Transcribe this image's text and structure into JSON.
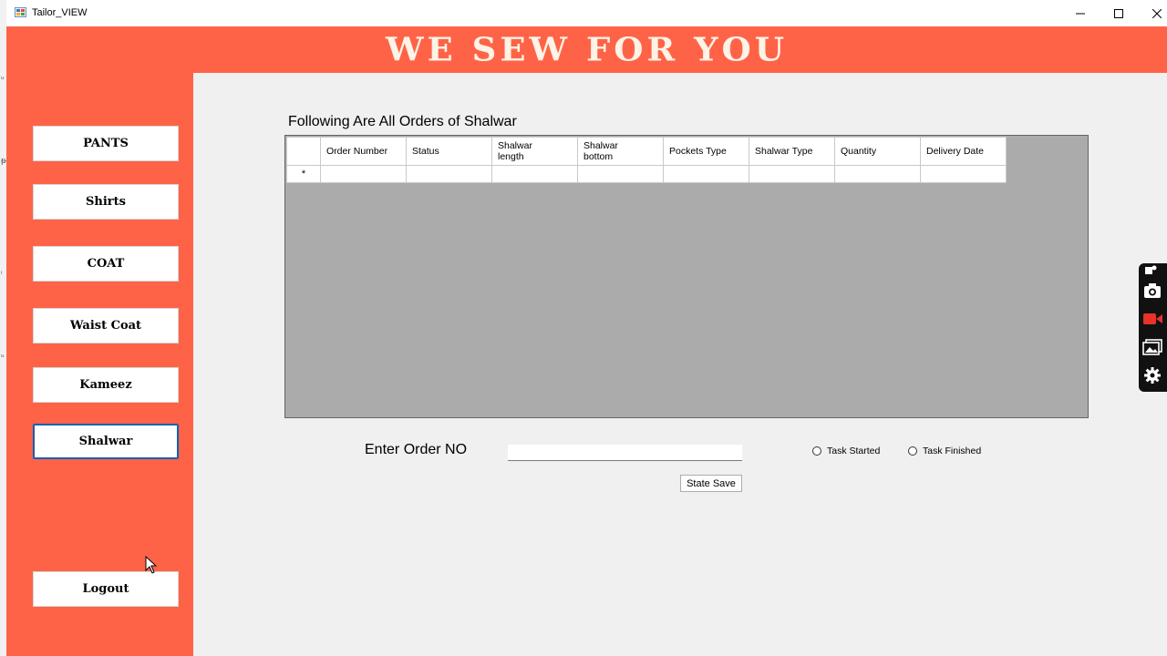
{
  "window": {
    "title": "Tailor_VIEW",
    "controls": [
      "minimize-icon",
      "maximize-icon",
      "close-icon"
    ]
  },
  "banner": {
    "title": "WE SEW FOR YOU"
  },
  "colors": {
    "accent": "#ff6347",
    "banner_text": "#fdf3e6",
    "grid_background": "#ababab",
    "content_background": "#f0f0f0"
  },
  "sidebar": {
    "items": [
      {
        "label": "PANTS"
      },
      {
        "label": "Shirts"
      },
      {
        "label": "COAT"
      },
      {
        "label": "Waist Coat"
      },
      {
        "label": "Kameez"
      },
      {
        "label": "Shalwar"
      }
    ],
    "logout_label": "Logout",
    "selected": "Shalwar"
  },
  "main": {
    "grid_title": "Following Are All Orders of Shalwar",
    "columns": [
      {
        "label": "Order Number"
      },
      {
        "label": "Status"
      },
      {
        "label": "Shalwar\nlength"
      },
      {
        "label": "Shalwar\nbottom"
      },
      {
        "label": "Pockets Type"
      },
      {
        "label": "Shalwar Type"
      },
      {
        "label": "Quantity"
      },
      {
        "label": "Delivery Date"
      }
    ],
    "new_row_marker": "*",
    "order_label": "Enter Order NO",
    "order_value": "",
    "radio_started": "Task Started",
    "radio_finished": "Task Finished",
    "save_label": "State Save"
  },
  "capture_toolbar": {
    "icons": [
      "pin-icon",
      "camera-icon",
      "video-record-icon",
      "gallery-icon",
      "settings-gear-icon"
    ]
  }
}
